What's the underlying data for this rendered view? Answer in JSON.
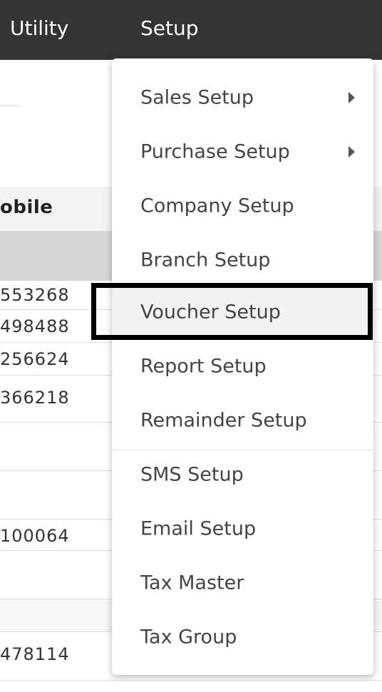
{
  "navbar": {
    "items": [
      {
        "label": "Utility"
      },
      {
        "label": "Setup"
      }
    ]
  },
  "table": {
    "header_label": "obile",
    "rows": [
      {
        "value": "553268"
      },
      {
        "value": "498488"
      },
      {
        "value": "256624"
      },
      {
        "value": "366218"
      },
      {
        "value": "100064"
      },
      {
        "value": "478114"
      }
    ]
  },
  "setup_menu": {
    "items": [
      {
        "label": "Sales Setup",
        "has_submenu": true
      },
      {
        "label": "Purchase Setup",
        "has_submenu": true
      },
      {
        "label": "Company Setup",
        "has_submenu": false
      },
      {
        "label": "Branch Setup",
        "has_submenu": false
      },
      {
        "label": "Voucher Setup",
        "has_submenu": false,
        "highlighted": true
      },
      {
        "label": "Report Setup",
        "has_submenu": false
      },
      {
        "label": "Remainder Setup",
        "has_submenu": false
      },
      {
        "label": "SMS Setup",
        "has_submenu": false
      },
      {
        "label": "Email Setup",
        "has_submenu": false
      },
      {
        "label": "Tax Master",
        "has_submenu": false
      },
      {
        "label": "Tax Group",
        "has_submenu": false
      }
    ]
  },
  "colors": {
    "navbar_bg": "#343434",
    "navbar_text": "#ffffff",
    "menu_text": "#444444",
    "highlight_border": "#000000"
  }
}
